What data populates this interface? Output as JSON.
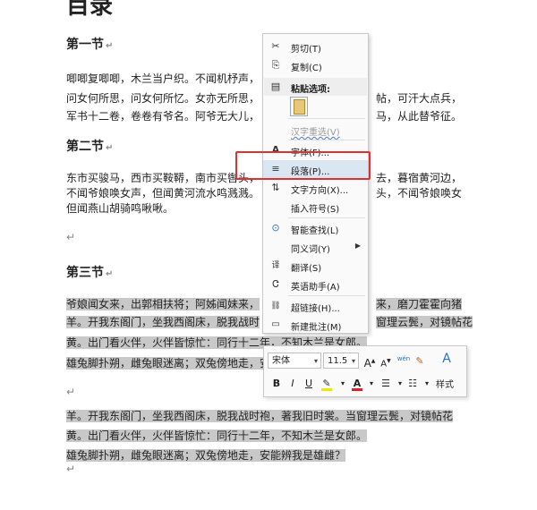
{
  "doc": {
    "title": "目录",
    "sections": [
      {
        "heading": "第一节",
        "lines": [
          "唧唧复唧唧，木兰当户织。不闻机杼声，",
          "问女何所思，问女何所忆。女亦无所思，",
          "军书十二卷，卷卷有爷名。阿爷无大儿，"
        ],
        "right_lines": [
          "帖，可汗大点兵，",
          "",
          "马，从此替爷征。"
        ]
      },
      {
        "heading": "第二节",
        "lines": [
          "东市买骏马，西市买鞍鞯，南市买辔头，",
          "不闻爷娘唤女声，但闻黄河流水鸣溅溅。",
          "但闻燕山胡骑鸣啾啾。"
        ],
        "right_lines": [
          "去，暮宿黄河边，",
          "头，不闻爷娘唤女",
          ""
        ]
      },
      {
        "heading": "第三节",
        "lines": [
          "爷娘闻女来，出郭相扶将；阿姊闻妹来，",
          "羊。开我东阁门，坐我西阁床，脱我战时",
          "黄。出门看火伴，火伴皆惊忙：同行十二年，不知木兰是女郎。",
          "雄兔脚扑朔，雌兔眼迷离；双兔傍地走，安",
          "",
          "羊。开我东阁门，坐我西阁床，脱我战时袍，著我旧时裳。当窗理云鬓，对镜帖花",
          "黄。出门看火伴，火伴皆惊忙：同行十二年，不知木兰是女郎。",
          "雄兔脚扑朔，雌兔眼迷离；双兔傍地走，安能辨我是雄雌？"
        ],
        "right_lines": [
          "来，磨刀霍霍向猪",
          "窗理云鬓，对镜帖花",
          "",
          ""
        ]
      }
    ]
  },
  "context_menu": {
    "items": [
      {
        "icon": "scissors-icon",
        "glyph": "✂",
        "label": "剪切(T)"
      },
      {
        "icon": "copy-icon",
        "glyph": "⎘",
        "label": "复制(C)"
      },
      {
        "icon": "paste-icon",
        "glyph": "📋",
        "label": "粘贴选项:"
      },
      {
        "icon": "",
        "glyph": "",
        "label": "汉字重选(V)",
        "disabled": true
      },
      {
        "icon": "font-icon",
        "glyph": "A",
        "label": "字体(F)..."
      },
      {
        "icon": "paragraph-icon",
        "glyph": "≡",
        "label": "段落(P)..."
      },
      {
        "icon": "text-direction-icon",
        "glyph": "⇅",
        "label": "文字方向(X)..."
      },
      {
        "icon": "",
        "glyph": "",
        "label": "插入符号(S)"
      },
      {
        "icon": "smart-lookup-icon",
        "glyph": "⊙",
        "label": "智能查找(L)"
      },
      {
        "icon": "",
        "glyph": "",
        "label": "同义词(Y)",
        "submenu": true
      },
      {
        "icon": "translate-icon",
        "glyph": "译",
        "label": "翻译(S)"
      },
      {
        "icon": "english-assistant-icon",
        "glyph": "Ꮳ",
        "label": "英语助手(A)"
      },
      {
        "icon": "hyperlink-icon",
        "glyph": "🔗",
        "label": "超链接(H)..."
      },
      {
        "icon": "new-comment-icon",
        "glyph": "🗨",
        "label": "新建批注(M)"
      }
    ]
  },
  "mini_toolbar": {
    "font_name": "宋体",
    "font_size": "11.5",
    "grow_font": "A",
    "shrink_font": "A",
    "phonetic": "wén",
    "bold": "B",
    "italic": "I",
    "underline": "U",
    "font_color_letter": "A",
    "styles_label": "样式"
  },
  "colors": {
    "highlight_box": "#e03030",
    "selection": "#c8c8c8",
    "menu_hover": "#dbe6f3"
  }
}
